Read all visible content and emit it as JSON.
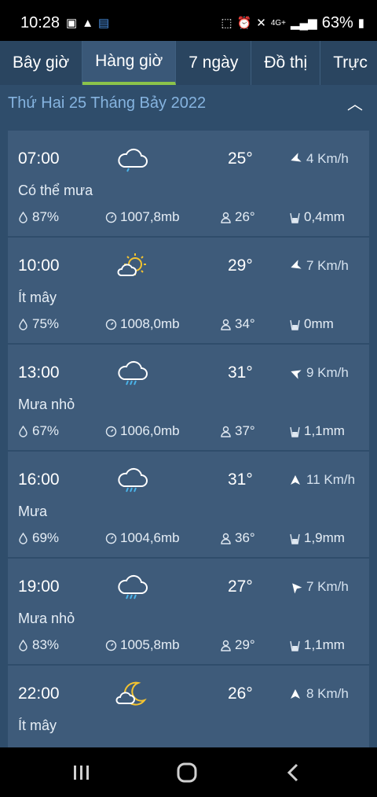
{
  "status_bar": {
    "time": "10:28",
    "battery": "63%",
    "network": "4G+"
  },
  "tabs": [
    {
      "label": "Bây giờ"
    },
    {
      "label": "Hàng giờ"
    },
    {
      "label": "7 ngày"
    },
    {
      "label": "Đồ thị"
    },
    {
      "label": "Trực"
    }
  ],
  "date_header": "Thứ Hai 25 Tháng Bảy 2022",
  "items": [
    {
      "time": "07:00",
      "temp": "25°",
      "wind": "4 Km/h",
      "desc": "Có thể mưa",
      "humidity": "87%",
      "pressure": "1007,8mb",
      "feels_like": "26°",
      "rain": "0,4mm",
      "icon": "cloud-drizzle-icon"
    },
    {
      "time": "10:00",
      "temp": "29°",
      "wind": "7 Km/h",
      "desc": "Ít mây",
      "humidity": "75%",
      "pressure": "1008,0mb",
      "feels_like": "34°",
      "rain": "0mm",
      "icon": "sun-cloud-icon"
    },
    {
      "time": "13:00",
      "temp": "31°",
      "wind": "9 Km/h",
      "desc": "Mưa nhỏ",
      "humidity": "67%",
      "pressure": "1006,0mb",
      "feels_like": "37°",
      "rain": "1,1mm",
      "icon": "cloud-rain-icon"
    },
    {
      "time": "16:00",
      "temp": "31°",
      "wind": "11 Km/h",
      "desc": "Mưa",
      "humidity": "69%",
      "pressure": "1004,6mb",
      "feels_like": "36°",
      "rain": "1,9mm",
      "icon": "cloud-rain-icon"
    },
    {
      "time": "19:00",
      "temp": "27°",
      "wind": "7 Km/h",
      "desc": "Mưa nhỏ",
      "humidity": "83%",
      "pressure": "1005,8mb",
      "feels_like": "29°",
      "rain": "1,1mm",
      "icon": "cloud-rain-icon"
    },
    {
      "time": "22:00",
      "temp": "26°",
      "wind": "8 Km/h",
      "desc": "Ít mây",
      "humidity": "",
      "pressure": "",
      "feels_like": "",
      "rain": "",
      "icon": "moon-cloud-icon"
    }
  ],
  "colors": {
    "accent": "#8bc34a",
    "date_text": "#86b4e0",
    "card_bg": "#3e5b7a",
    "page_bg": "#2f4d6b"
  }
}
